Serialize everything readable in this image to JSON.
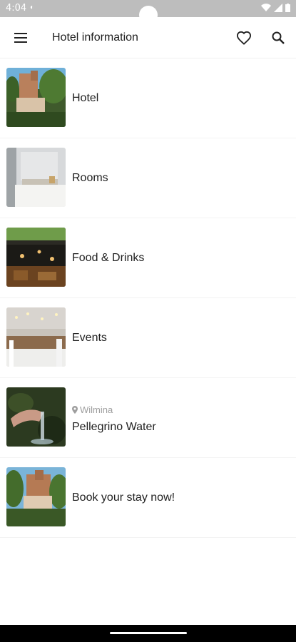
{
  "status_bar": {
    "time": "4:04"
  },
  "app_bar": {
    "title": "Hotel information"
  },
  "items": [
    {
      "label": "Hotel"
    },
    {
      "label": "Rooms"
    },
    {
      "label": "Food & Drinks"
    },
    {
      "label": "Events"
    },
    {
      "label": "Pellegrino Water",
      "location": "Wilmina"
    },
    {
      "label": "Book your stay now!"
    }
  ],
  "colors": {
    "status_bar": "#bdbdbd",
    "text": "#212121",
    "secondary": "#9e9e9e",
    "nav_bar": "#000000"
  }
}
